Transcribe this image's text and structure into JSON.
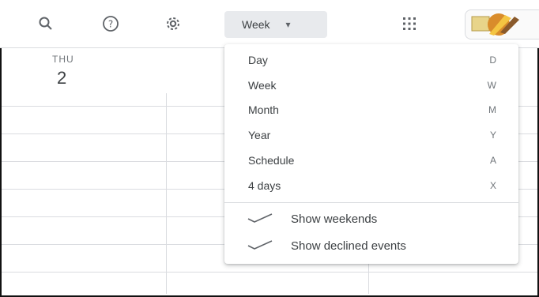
{
  "toolbar": {
    "icons": {
      "search": "search-icon",
      "help": "help-icon",
      "settings": "gear-icon",
      "apps": "apps-grid-icon"
    },
    "view_label": "Week",
    "view_caret": "▾",
    "avatar": "account-avatar"
  },
  "calendar": {
    "day_name": "THU",
    "day_number": "2"
  },
  "menu": {
    "items": [
      {
        "label": "Day",
        "shortcut": "D"
      },
      {
        "label": "Week",
        "shortcut": "W"
      },
      {
        "label": "Month",
        "shortcut": "M"
      },
      {
        "label": "Year",
        "shortcut": "Y"
      },
      {
        "label": "Schedule",
        "shortcut": "A"
      },
      {
        "label": "4 days",
        "shortcut": "X"
      }
    ],
    "toggles": [
      {
        "label": "Show weekends",
        "checked": true
      },
      {
        "label": "Show declined events",
        "checked": true
      }
    ]
  },
  "colors": {
    "accent_bg": "#e8eaed",
    "grid_line": "#dadce0",
    "text": "#3c4043",
    "muted": "#70757a"
  }
}
